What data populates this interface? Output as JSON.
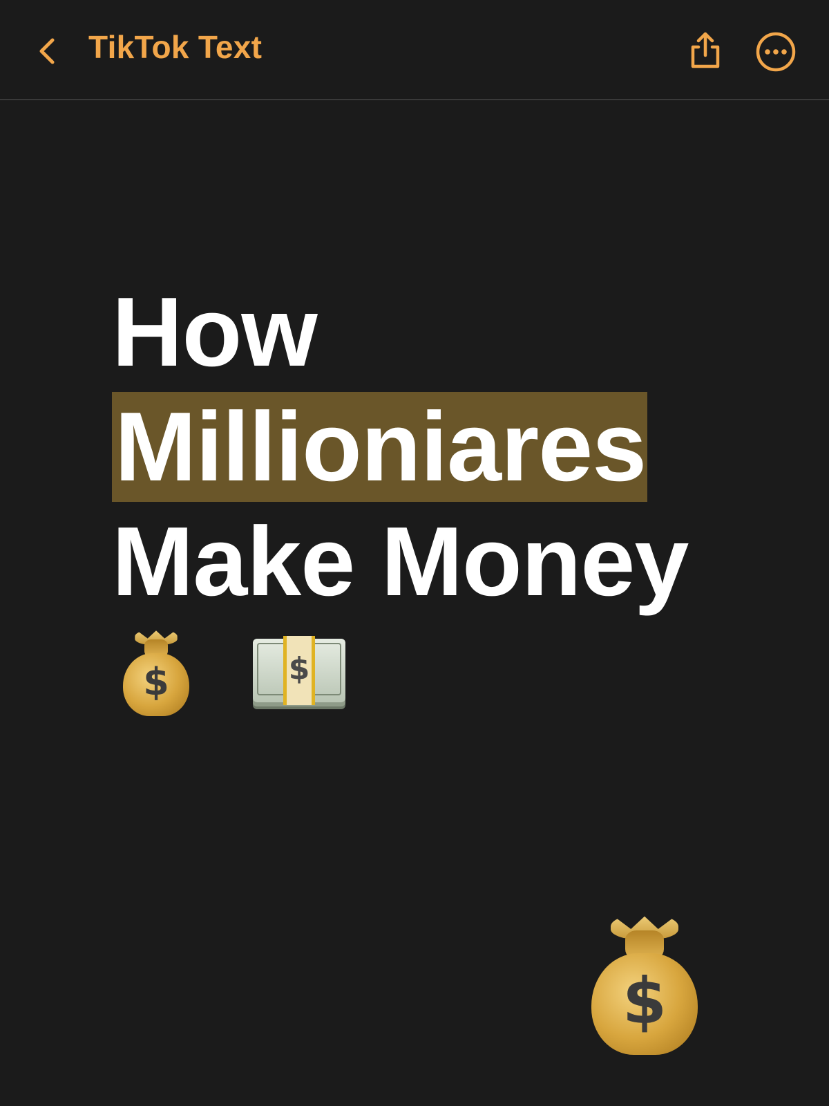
{
  "nav": {
    "title": "TikTok Text",
    "back_icon": "chevron-left-icon",
    "share_icon": "share-icon",
    "more_icon": "ellipsis-circle-icon"
  },
  "note": {
    "heading_lines": {
      "line1": "How",
      "line2": "Millioniares",
      "line3": "Make Money"
    },
    "emojis": [
      "money-bag",
      "dollar-banknote",
      "money-bag"
    ]
  },
  "colors": {
    "accent": "#f2a64a",
    "background": "#1b1b1b",
    "highlight": "#6a5629",
    "text": "#ffffff"
  }
}
